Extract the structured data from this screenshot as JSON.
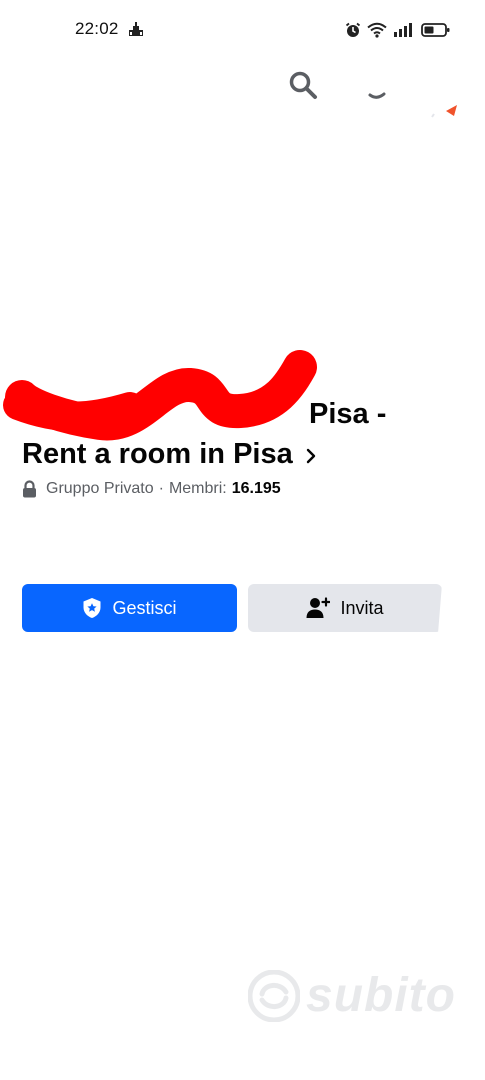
{
  "status_bar": {
    "time": "22:02"
  },
  "group": {
    "title_line1": "Pisa -",
    "title_line2": "Rent a room in Pisa",
    "privacy": "Gruppo Privato",
    "separator": "·",
    "members_label": "Membri:",
    "members_count": "16.195"
  },
  "actions": {
    "manage_label": "Gestisci",
    "invite_label": "Invita"
  },
  "colors": {
    "primary": "#0866ff",
    "secondary_button": "#e4e6eb",
    "redaction": "#ff0000"
  },
  "watermark": {
    "text": "subito"
  }
}
